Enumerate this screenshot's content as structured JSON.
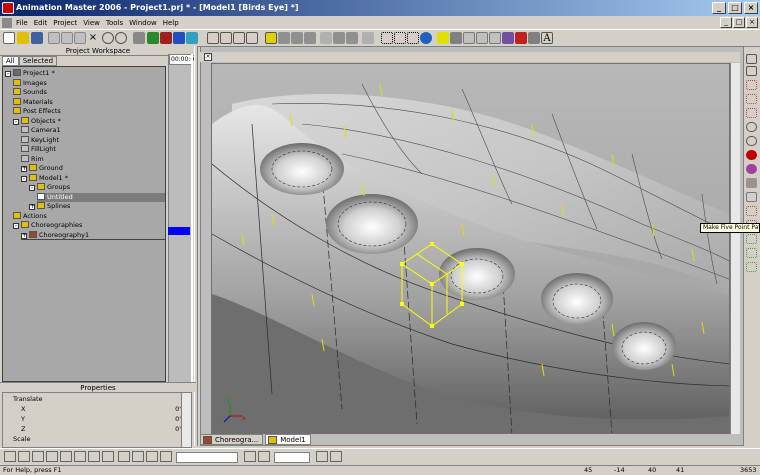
{
  "window": {
    "title": "Animation Master 2006 - Project1.prj * - [Model1 [Birds Eye] *]",
    "min": "_",
    "max": "□",
    "close": "×"
  },
  "menu": [
    "File",
    "Edit",
    "Project",
    "View",
    "Tools",
    "Window",
    "Help"
  ],
  "mdi_controls": {
    "min": "_",
    "restore": "□",
    "close": "×"
  },
  "workspace": {
    "title": "Project Workspace",
    "tabs": [
      "All",
      "Selected"
    ],
    "timecode": "00:00:0",
    "tree": [
      {
        "label": "Project1 *",
        "indent": 0,
        "exp": "-",
        "icon": "project-icon",
        "color": "#6a6a6a"
      },
      {
        "label": "Images",
        "indent": 1,
        "icon": "folder-icon",
        "color": "#e0c000"
      },
      {
        "label": "Sounds",
        "indent": 1,
        "icon": "folder-icon",
        "color": "#e0c000"
      },
      {
        "label": "Materials",
        "indent": 1,
        "icon": "folder-icon",
        "color": "#e0c000"
      },
      {
        "label": "Post Effects",
        "indent": 1,
        "icon": "folder-icon",
        "color": "#e0c000"
      },
      {
        "label": "Objects *",
        "indent": 1,
        "exp": "-",
        "icon": "folder-icon",
        "color": "#e0c000"
      },
      {
        "label": "Camera1",
        "indent": 2,
        "icon": "camera-icon",
        "color": "#c0c0c0"
      },
      {
        "label": "KeyLight",
        "indent": 2,
        "icon": "light-icon",
        "color": "#c0c0c0"
      },
      {
        "label": "FillLight",
        "indent": 2,
        "icon": "light-icon",
        "color": "#c0c0c0"
      },
      {
        "label": "Rim",
        "indent": 2,
        "icon": "light-icon",
        "color": "#c0c0c0"
      },
      {
        "label": "Ground",
        "indent": 2,
        "exp": "+",
        "icon": "model-icon",
        "color": "#e0c000"
      },
      {
        "label": "Model1 *",
        "indent": 2,
        "exp": "-",
        "icon": "model-icon",
        "color": "#e0c000"
      },
      {
        "label": "Groups",
        "indent": 3,
        "exp": "-",
        "icon": "folder-icon",
        "color": "#e0c000"
      },
      {
        "label": "Untitled",
        "indent": 4,
        "icon": "group-icon",
        "color": "#ffffff",
        "selected": true
      },
      {
        "label": "Splines",
        "indent": 3,
        "exp": "+",
        "icon": "folder-icon",
        "color": "#e0c000"
      },
      {
        "label": "Actions",
        "indent": 1,
        "icon": "folder-icon",
        "color": "#e0c000"
      },
      {
        "label": "Choreographies",
        "indent": 1,
        "exp": "-",
        "icon": "folder-icon",
        "color": "#e0c000"
      },
      {
        "label": "Choreography1",
        "indent": 2,
        "exp": "+",
        "icon": "choreography-icon",
        "color": "#9a4a2a"
      }
    ]
  },
  "properties": {
    "title": "Properties",
    "rows": [
      {
        "label": "Translate",
        "value": "",
        "group": true
      },
      {
        "label": "X",
        "value": "0'"
      },
      {
        "label": "Y",
        "value": "0'"
      },
      {
        "label": "Z",
        "value": "0'"
      },
      {
        "label": "Scale",
        "value": "",
        "group": true
      }
    ]
  },
  "viewport": {
    "tooltip": "Make Five Point Patch",
    "axis_x": "x",
    "axis_y": "y"
  },
  "doc_tabs": [
    "Choreogra...",
    "Model1"
  ],
  "status": {
    "help": "For Help, press F1",
    "x": "45",
    "y": "-14",
    "z": "40",
    "w": "41",
    "patches": "3653"
  },
  "colors": {
    "accent": "#0a246a",
    "highlight": "#0000ff",
    "spline": "#ffff00"
  }
}
